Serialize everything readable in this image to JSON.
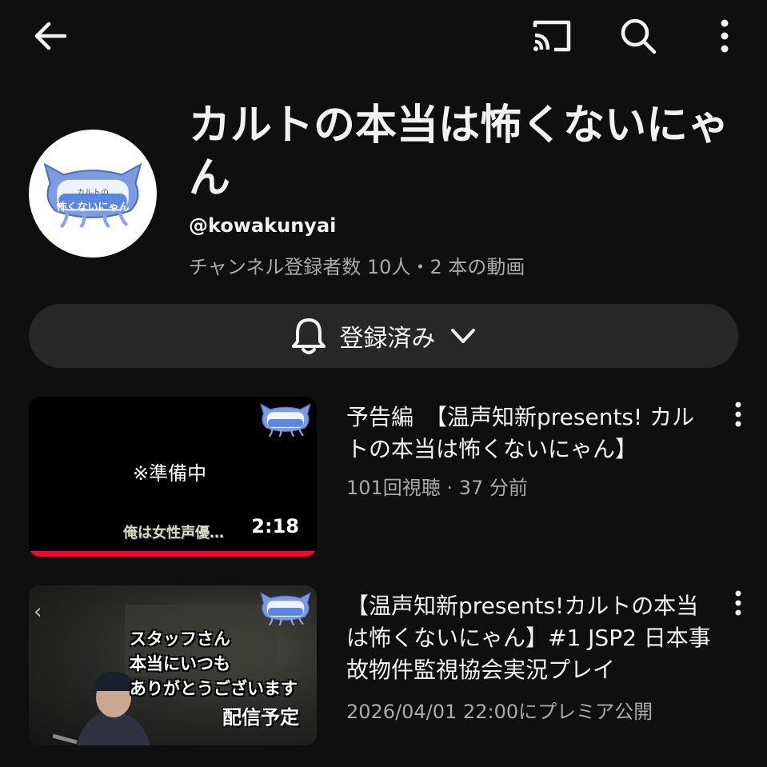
{
  "topbar": {
    "back_icon": "arrow-left-icon",
    "cast_icon": "cast-icon",
    "search_icon": "search-icon",
    "more_icon": "more-vertical-icon"
  },
  "channel": {
    "title": "カルトの本当は怖くないにゃん",
    "handle": "@kowakunyai",
    "stats": "チャンネル登録者数 10人・2 本の動画",
    "avatar_logo_text": "本当は カルトの 怖くないにゃん"
  },
  "subscribe": {
    "label": "登録済み",
    "bell_icon": "bell-icon",
    "chevron_icon": "chevron-down-icon"
  },
  "videos": [
    {
      "title": "予告編　【温声知新presents! カルトの本当は怖くないにゃん】",
      "meta": "101回視聴 · 37 分前",
      "duration": "2:18",
      "thumb_text": "※準備中",
      "thumb_caption": "俺は女性声優…",
      "watched_fraction": 1.0
    },
    {
      "title": "【温声知新presents!カルトの本当は怖くないにゃん】#1 JSP2 日本事故物件監視協会実況プレイ",
      "meta": "2026/04/01 22:00にプレミア公開",
      "thumb_lines": [
        "スタッフさん",
        "本当にいつも",
        "ありがとうございます"
      ],
      "thumb_badge": "配信予定",
      "thumb_chevron": "‹"
    }
  ],
  "colors": {
    "background": "#0f0f0f",
    "text": "#f1f1f1",
    "secondary_text": "#aaaaaa",
    "button_bg": "#272727",
    "progress": "#ff0033",
    "logo_blue": "#6f8fd8"
  }
}
